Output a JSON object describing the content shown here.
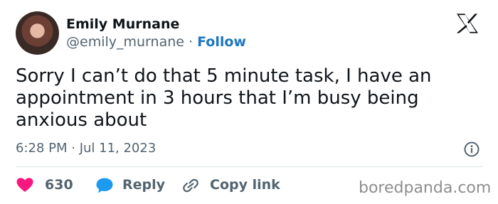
{
  "author": {
    "name": "Emily Murnane",
    "handle": "@emily_murnane",
    "separator": "·",
    "follow_label": "Follow"
  },
  "tweet": {
    "text": "Sorry I can’t do that 5 minute task, I have an appointment in 3 hours that I’m busy being anxious about",
    "timestamp": "6:28 PM · Jul 11, 2023"
  },
  "actions": {
    "like_count": "630",
    "reply_label": "Reply",
    "copy_link_label": "Copy link"
  },
  "watermark": "boredpanda.com",
  "icons": {
    "logo": "x-logo-icon",
    "info": "info-icon",
    "like": "heart-icon",
    "reply": "speech-bubble-icon",
    "copy": "link-icon"
  },
  "colors": {
    "text": "#0f1419",
    "secondary": "#536471",
    "link": "#1d76c0",
    "heart": "#f91880",
    "reply_bubble": "#1d9bf0",
    "watermark": "#8e8e8e"
  }
}
